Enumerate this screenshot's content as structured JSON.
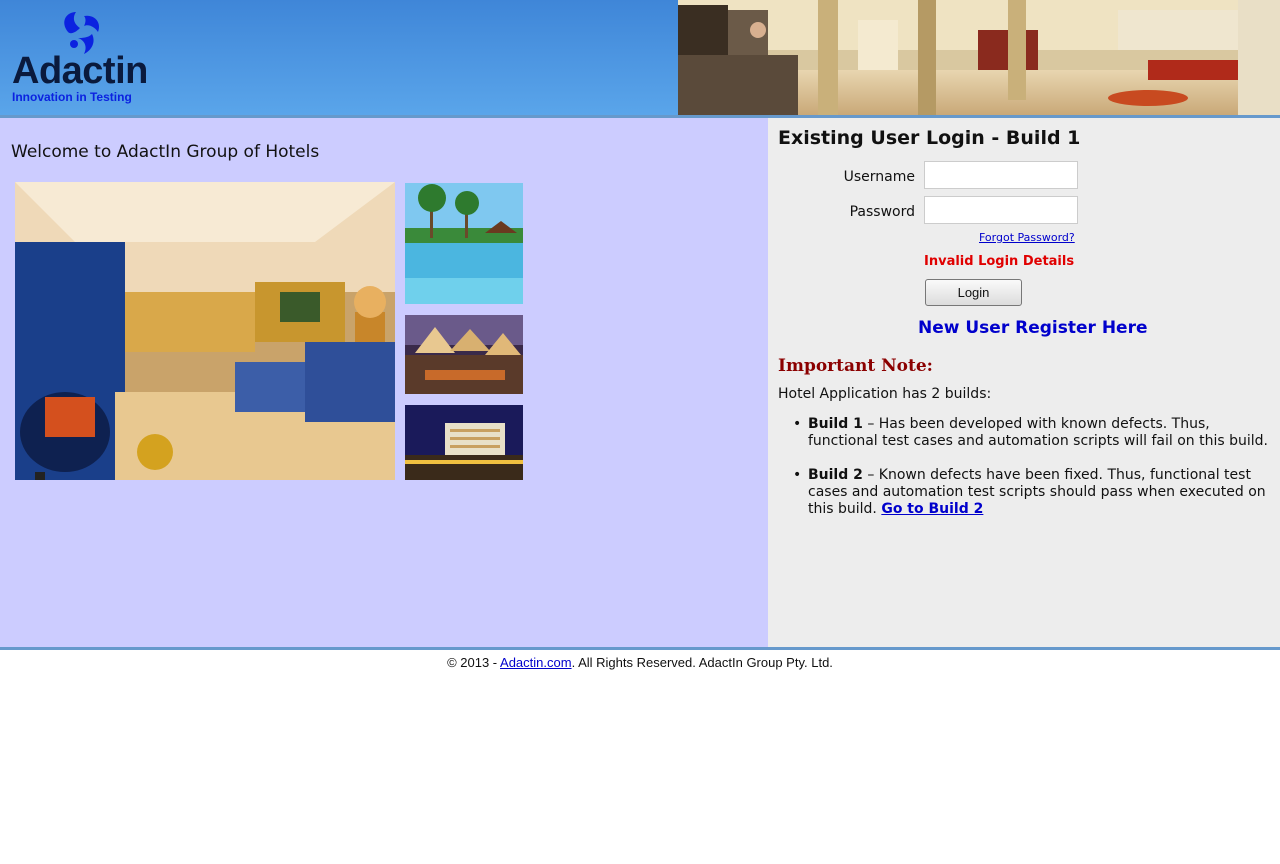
{
  "header": {
    "logo_text": "Adactin",
    "logo_tagline": "Innovation in Testing"
  },
  "left": {
    "welcome": "Welcome to AdactIn Group of Hotels"
  },
  "login": {
    "title": "Existing User Login - Build 1",
    "username_label": "Username",
    "password_label": "Password",
    "username_value": "",
    "password_value": "",
    "forgot_password": "Forgot Password?",
    "error": "Invalid Login Details",
    "login_button": "Login",
    "register_link": "New User Register Here"
  },
  "note": {
    "title": "Important Note:",
    "intro": "Hotel Application has 2 builds:",
    "build1_label": "Build 1",
    "build1_text": " – Has been developed with known defects. Thus, functional test cases and automation scripts will fail on this build.",
    "build2_label": "Build 2",
    "build2_text": " – Known defects have been fixed. Thus, functional test cases and automation test scripts should pass when executed on this build. ",
    "build2_link": "Go to Build 2"
  },
  "footer": {
    "prefix": "© 2013 - ",
    "link": "Adactin.com",
    "suffix": ". All Rights Reserved. AdactIn Group Pty. Ltd."
  },
  "colors": {
    "header_blue": "#4a94e0",
    "left_panel": "#ccccff",
    "right_panel": "#ededed",
    "error_red": "#e00000",
    "link_blue": "#0000cc",
    "note_title": "#8b0000"
  }
}
